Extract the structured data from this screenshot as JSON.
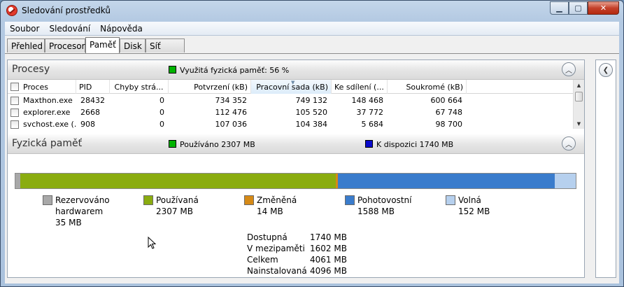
{
  "window": {
    "title": "Sledování prostředků"
  },
  "menu": [
    "Soubor",
    "Sledování",
    "Nápověda"
  ],
  "tabs": [
    "Přehled",
    "Procesor",
    "Paměť",
    "Disk",
    "Síť"
  ],
  "processes": {
    "title": "Procesy",
    "summary": "Využitá fyzická paměť: 56 %",
    "summary_color": "#00b300",
    "columns": [
      "Proces",
      "PID",
      "Chyby strá...",
      "Potvrzení (kB)",
      "Pracovní sada (kB)",
      "Ke sdílení (...",
      "Soukromé (kB)"
    ],
    "rows": [
      [
        "Maxthon.exe",
        "28432",
        "0",
        "734 352",
        "749 132",
        "148 468",
        "600 664"
      ],
      [
        "explorer.exe",
        "2668",
        "0",
        "112 476",
        "105 520",
        "37 772",
        "67 748"
      ],
      [
        "svchost.exe (...",
        "908",
        "0",
        "107 036",
        "104 384",
        "5 684",
        "98 700"
      ]
    ]
  },
  "physical": {
    "title": "Fyzická paměť",
    "in_use": "Používáno 2307 MB",
    "available": "K dispozici 1740 MB",
    "in_use_color": "#00b300",
    "available_color": "#0a0acc",
    "bar": [
      {
        "fraction": 0.0086,
        "color": "#a8a8a8"
      },
      {
        "fraction": 0.568,
        "color": "#8aac10"
      },
      {
        "fraction": 0.0034,
        "color": "#d68a16"
      },
      {
        "fraction": 0.391,
        "color": "#3a7ccc"
      },
      {
        "fraction": 0.0374,
        "color": "#b6d0ee"
      }
    ],
    "legend": [
      {
        "name": "Rezervováno",
        "name2": "hardwarem",
        "value": "35 MB",
        "color": "#a8a8a8"
      },
      {
        "name": "Používaná",
        "name2": "",
        "value": "2307 MB",
        "color": "#8aac10"
      },
      {
        "name": "Změněná",
        "name2": "",
        "value": "14 MB",
        "color": "#d68a16"
      },
      {
        "name": "Pohotovostní",
        "name2": "",
        "value": "1588 MB",
        "color": "#3a7ccc"
      },
      {
        "name": "Volná",
        "name2": "",
        "value": "152 MB",
        "color": "#b6d0ee"
      }
    ],
    "stats": [
      {
        "label": "Dostupná",
        "value": "1740 MB"
      },
      {
        "label": "V mezipaměti",
        "value": "1602 MB"
      },
      {
        "label": "Celkem",
        "value": "4061 MB"
      },
      {
        "label": "Nainstalovaná",
        "value": "4096 MB"
      }
    ]
  },
  "icons": {
    "collapse": "collapse-up-icon",
    "side_collapse": "chevron-left-icon"
  }
}
